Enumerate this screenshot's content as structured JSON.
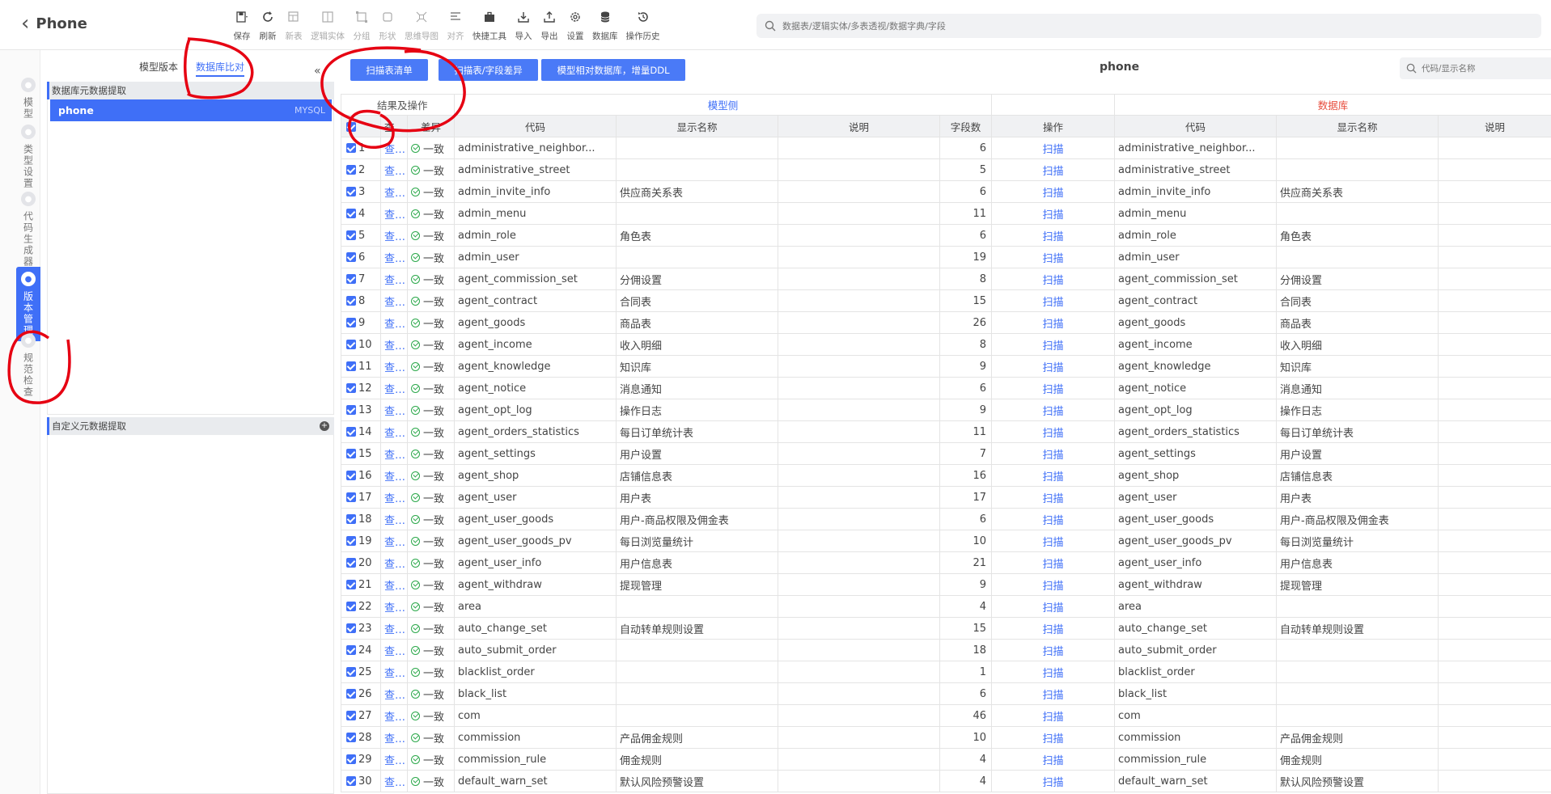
{
  "app": {
    "title": "Phone"
  },
  "toolbar": [
    {
      "label": "保存",
      "icon": "save-icon",
      "disabled": false
    },
    {
      "label": "刷新",
      "icon": "refresh-icon",
      "disabled": false
    },
    {
      "label": "新表",
      "icon": "new-table-icon",
      "disabled": true
    },
    {
      "label": "逻辑实体",
      "icon": "logic-entity-icon",
      "disabled": true
    },
    {
      "label": "分组",
      "icon": "group-icon",
      "disabled": true
    },
    {
      "label": "形状",
      "icon": "shape-icon",
      "disabled": true
    },
    {
      "label": "思维导图",
      "icon": "mindmap-icon",
      "disabled": true
    },
    {
      "label": "对齐",
      "icon": "align-icon",
      "disabled": true
    },
    {
      "label": "快捷工具",
      "icon": "toolbox-icon",
      "disabled": false
    },
    {
      "label": "导入",
      "icon": "import-icon",
      "disabled": false
    },
    {
      "label": "导出",
      "icon": "export-icon",
      "disabled": false
    },
    {
      "label": "设置",
      "icon": "gear-icon",
      "disabled": false
    },
    {
      "label": "数据库",
      "icon": "database-icon",
      "disabled": false
    },
    {
      "label": "操作历史",
      "icon": "history-icon",
      "disabled": false
    }
  ],
  "search": {
    "placeholder": "数据表/逻辑实体/多表透视/数据字典/字段"
  },
  "rail": [
    {
      "label": "模型",
      "icon": "model-icon",
      "active": false
    },
    {
      "label": "类型设置",
      "icon": "type-settings-icon",
      "active": false
    },
    {
      "label": "代码生成器",
      "icon": "code-generator-icon",
      "active": false
    },
    {
      "label": "版本管理",
      "icon": "version-management-icon",
      "active": true
    },
    {
      "label": "规范检查",
      "icon": "standard-check-icon",
      "active": false
    }
  ],
  "left_panel": {
    "tab_model_version": "模型版本",
    "tab_db_compare": "数据库比对",
    "collapse": "«",
    "section1_title": "数据库元数据提取",
    "db_item": {
      "name": "phone",
      "type": "MYSQL"
    },
    "section2_title": "自定义元数据提取",
    "add": "+"
  },
  "main": {
    "btn_scan_list": "扫描表清单",
    "btn_scan_diff": "扫描表/字段差异",
    "btn_ddl": "模型相对数据库，增量DDL",
    "title": "phone",
    "search_placeholder": "代码/显示名称",
    "group_headers": {
      "result": "结果及操作",
      "model": "模型侧",
      "database": "数据库"
    },
    "columns": [
      "查看",
      "差异",
      "代码",
      "显示名称",
      "说明",
      "字段数",
      "操作",
      "代码",
      "显示名称",
      "说明"
    ],
    "rows": [
      {
        "n": "1",
        "view": "查看",
        "diff": "一致",
        "code": "administrative_neighbor...",
        "name": "",
        "desc": "",
        "count": "6",
        "op": "扫描",
        "db_code": "administrative_neighbor...",
        "db_name": ""
      },
      {
        "n": "2",
        "view": "查看",
        "diff": "一致",
        "code": "administrative_street",
        "name": "",
        "desc": "",
        "count": "5",
        "op": "扫描",
        "db_code": "administrative_street",
        "db_name": ""
      },
      {
        "n": "3",
        "view": "查看",
        "diff": "一致",
        "code": "admin_invite_info",
        "name": "供应商关系表",
        "desc": "",
        "count": "6",
        "op": "扫描",
        "db_code": "admin_invite_info",
        "db_name": "供应商关系表"
      },
      {
        "n": "4",
        "view": "查看",
        "diff": "一致",
        "code": "admin_menu",
        "name": "",
        "desc": "",
        "count": "11",
        "op": "扫描",
        "db_code": "admin_menu",
        "db_name": ""
      },
      {
        "n": "5",
        "view": "查看",
        "diff": "一致",
        "code": "admin_role",
        "name": "角色表",
        "desc": "",
        "count": "6",
        "op": "扫描",
        "db_code": "admin_role",
        "db_name": "角色表"
      },
      {
        "n": "6",
        "view": "查看",
        "diff": "一致",
        "code": "admin_user",
        "name": "",
        "desc": "",
        "count": "19",
        "op": "扫描",
        "db_code": "admin_user",
        "db_name": ""
      },
      {
        "n": "7",
        "view": "查看",
        "diff": "一致",
        "code": "agent_commission_set",
        "name": "分佣设置",
        "desc": "",
        "count": "8",
        "op": "扫描",
        "db_code": "agent_commission_set",
        "db_name": "分佣设置"
      },
      {
        "n": "8",
        "view": "查看",
        "diff": "一致",
        "code": "agent_contract",
        "name": "合同表",
        "desc": "",
        "count": "15",
        "op": "扫描",
        "db_code": "agent_contract",
        "db_name": "合同表"
      },
      {
        "n": "9",
        "view": "查看",
        "diff": "一致",
        "code": "agent_goods",
        "name": "商品表",
        "desc": "",
        "count": "26",
        "op": "扫描",
        "db_code": "agent_goods",
        "db_name": "商品表"
      },
      {
        "n": "10",
        "view": "查看",
        "diff": "一致",
        "code": "agent_income",
        "name": "收入明细",
        "desc": "",
        "count": "8",
        "op": "扫描",
        "db_code": "agent_income",
        "db_name": "收入明细"
      },
      {
        "n": "11",
        "view": "查看",
        "diff": "一致",
        "code": "agent_knowledge",
        "name": "知识库",
        "desc": "",
        "count": "9",
        "op": "扫描",
        "db_code": "agent_knowledge",
        "db_name": "知识库"
      },
      {
        "n": "12",
        "view": "查看",
        "diff": "一致",
        "code": "agent_notice",
        "name": "消息通知",
        "desc": "",
        "count": "6",
        "op": "扫描",
        "db_code": "agent_notice",
        "db_name": "消息通知"
      },
      {
        "n": "13",
        "view": "查看",
        "diff": "一致",
        "code": "agent_opt_log",
        "name": "操作日志",
        "desc": "",
        "count": "9",
        "op": "扫描",
        "db_code": "agent_opt_log",
        "db_name": "操作日志"
      },
      {
        "n": "14",
        "view": "查看",
        "diff": "一致",
        "code": "agent_orders_statistics",
        "name": "每日订单统计表",
        "desc": "",
        "count": "11",
        "op": "扫描",
        "db_code": "agent_orders_statistics",
        "db_name": "每日订单统计表"
      },
      {
        "n": "15",
        "view": "查看",
        "diff": "一致",
        "code": "agent_settings",
        "name": "用户设置",
        "desc": "",
        "count": "7",
        "op": "扫描",
        "db_code": "agent_settings",
        "db_name": "用户设置"
      },
      {
        "n": "16",
        "view": "查看",
        "diff": "一致",
        "code": "agent_shop",
        "name": "店铺信息表",
        "desc": "",
        "count": "16",
        "op": "扫描",
        "db_code": "agent_shop",
        "db_name": "店铺信息表"
      },
      {
        "n": "17",
        "view": "查看",
        "diff": "一致",
        "code": "agent_user",
        "name": "用户表",
        "desc": "",
        "count": "17",
        "op": "扫描",
        "db_code": "agent_user",
        "db_name": "用户表"
      },
      {
        "n": "18",
        "view": "查看",
        "diff": "一致",
        "code": "agent_user_goods",
        "name": "用户-商品权限及佣金表",
        "desc": "",
        "count": "6",
        "op": "扫描",
        "db_code": "agent_user_goods",
        "db_name": "用户-商品权限及佣金表"
      },
      {
        "n": "19",
        "view": "查看",
        "diff": "一致",
        "code": "agent_user_goods_pv",
        "name": "每日浏览量统计",
        "desc": "",
        "count": "10",
        "op": "扫描",
        "db_code": "agent_user_goods_pv",
        "db_name": "每日浏览量统计"
      },
      {
        "n": "20",
        "view": "查看",
        "diff": "一致",
        "code": "agent_user_info",
        "name": "用户信息表",
        "desc": "",
        "count": "21",
        "op": "扫描",
        "db_code": "agent_user_info",
        "db_name": "用户信息表"
      },
      {
        "n": "21",
        "view": "查看",
        "diff": "一致",
        "code": "agent_withdraw",
        "name": "提现管理",
        "desc": "",
        "count": "9",
        "op": "扫描",
        "db_code": "agent_withdraw",
        "db_name": "提现管理"
      },
      {
        "n": "22",
        "view": "查看",
        "diff": "一致",
        "code": "area",
        "name": "",
        "desc": "",
        "count": "4",
        "op": "扫描",
        "db_code": "area",
        "db_name": ""
      },
      {
        "n": "23",
        "view": "查看",
        "diff": "一致",
        "code": "auto_change_set",
        "name": "自动转单规则设置",
        "desc": "",
        "count": "15",
        "op": "扫描",
        "db_code": "auto_change_set",
        "db_name": "自动转单规则设置"
      },
      {
        "n": "24",
        "view": "查看",
        "diff": "一致",
        "code": "auto_submit_order",
        "name": "",
        "desc": "",
        "count": "18",
        "op": "扫描",
        "db_code": "auto_submit_order",
        "db_name": ""
      },
      {
        "n": "25",
        "view": "查看",
        "diff": "一致",
        "code": "blacklist_order",
        "name": "",
        "desc": "",
        "count": "1",
        "op": "扫描",
        "db_code": "blacklist_order",
        "db_name": ""
      },
      {
        "n": "26",
        "view": "查看",
        "diff": "一致",
        "code": "black_list",
        "name": "",
        "desc": "",
        "count": "6",
        "op": "扫描",
        "db_code": "black_list",
        "db_name": ""
      },
      {
        "n": "27",
        "view": "查看",
        "diff": "一致",
        "code": "com",
        "name": "",
        "desc": "",
        "count": "46",
        "op": "扫描",
        "db_code": "com",
        "db_name": ""
      },
      {
        "n": "28",
        "view": "查看",
        "diff": "一致",
        "code": "commission",
        "name": "产品佣金规则",
        "desc": "",
        "count": "10",
        "op": "扫描",
        "db_code": "commission",
        "db_name": "产品佣金规则"
      },
      {
        "n": "29",
        "view": "查看",
        "diff": "一致",
        "code": "commission_rule",
        "name": "佣金规则",
        "desc": "",
        "count": "4",
        "op": "扫描",
        "db_code": "commission_rule",
        "db_name": "佣金规则"
      },
      {
        "n": "30",
        "view": "查看",
        "diff": "一致",
        "code": "default_warn_set",
        "name": "默认风险预警设置",
        "desc": "",
        "count": "4",
        "op": "扫描",
        "db_code": "default_warn_set",
        "db_name": "默认风险预警设置"
      }
    ]
  },
  "colors": {
    "accent": "#3f6ff7",
    "ok": "#2ba84a",
    "db_header": "#e74c3c",
    "annotation": "#e60012"
  }
}
